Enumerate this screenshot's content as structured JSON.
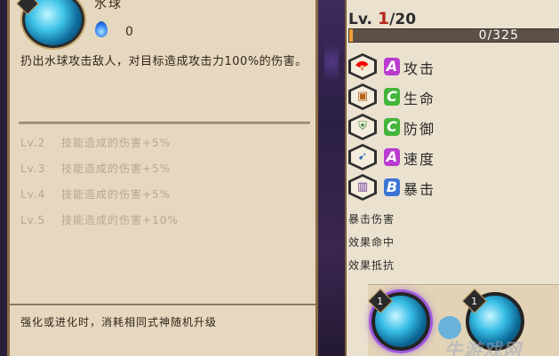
{
  "skill": {
    "name": "水球",
    "mana_cost": "0",
    "description": "扔出水球攻击敌人，对目标造成攻击力100%的伤害。",
    "levels": [
      {
        "lv": "Lv.2",
        "effect": "技能造成的伤害+5%"
      },
      {
        "lv": "Lv.3",
        "effect": "技能造成的伤害+5%"
      },
      {
        "lv": "Lv.4",
        "effect": "技能造成的伤害+5%"
      },
      {
        "lv": "Lv.5",
        "effect": "技能造成的伤害+10%"
      }
    ],
    "footer": "强化或进化时，消耗相同式神随机升级"
  },
  "stats": {
    "level_prefix": "Lv.",
    "level_current": "1",
    "level_max": "/20",
    "exp_text": "0/325",
    "exp_fraction": 0.015,
    "rows": [
      {
        "grade": "A",
        "grade_color": "#b93ccf",
        "name": "攻击",
        "icon": "fan-icon"
      },
      {
        "grade": "C",
        "grade_color": "#43b53a",
        "name": "生命",
        "icon": "scroll-icon"
      },
      {
        "grade": "C",
        "grade_color": "#43b53a",
        "name": "防御",
        "icon": "armor-icon"
      },
      {
        "grade": "A",
        "grade_color": "#b93ccf",
        "name": "速度",
        "icon": "boot-icon"
      },
      {
        "grade": "B",
        "grade_color": "#3a74d6",
        "name": "暴击",
        "icon": "scroll-critical-icon"
      }
    ],
    "sub_stats": [
      "暴击伤害",
      "效果命中",
      "效果抵抗"
    ]
  },
  "slots": [
    {
      "badge": "1",
      "selected": true
    },
    {
      "badge": "1",
      "selected": false
    }
  ],
  "watermark": "牛游戏网"
}
